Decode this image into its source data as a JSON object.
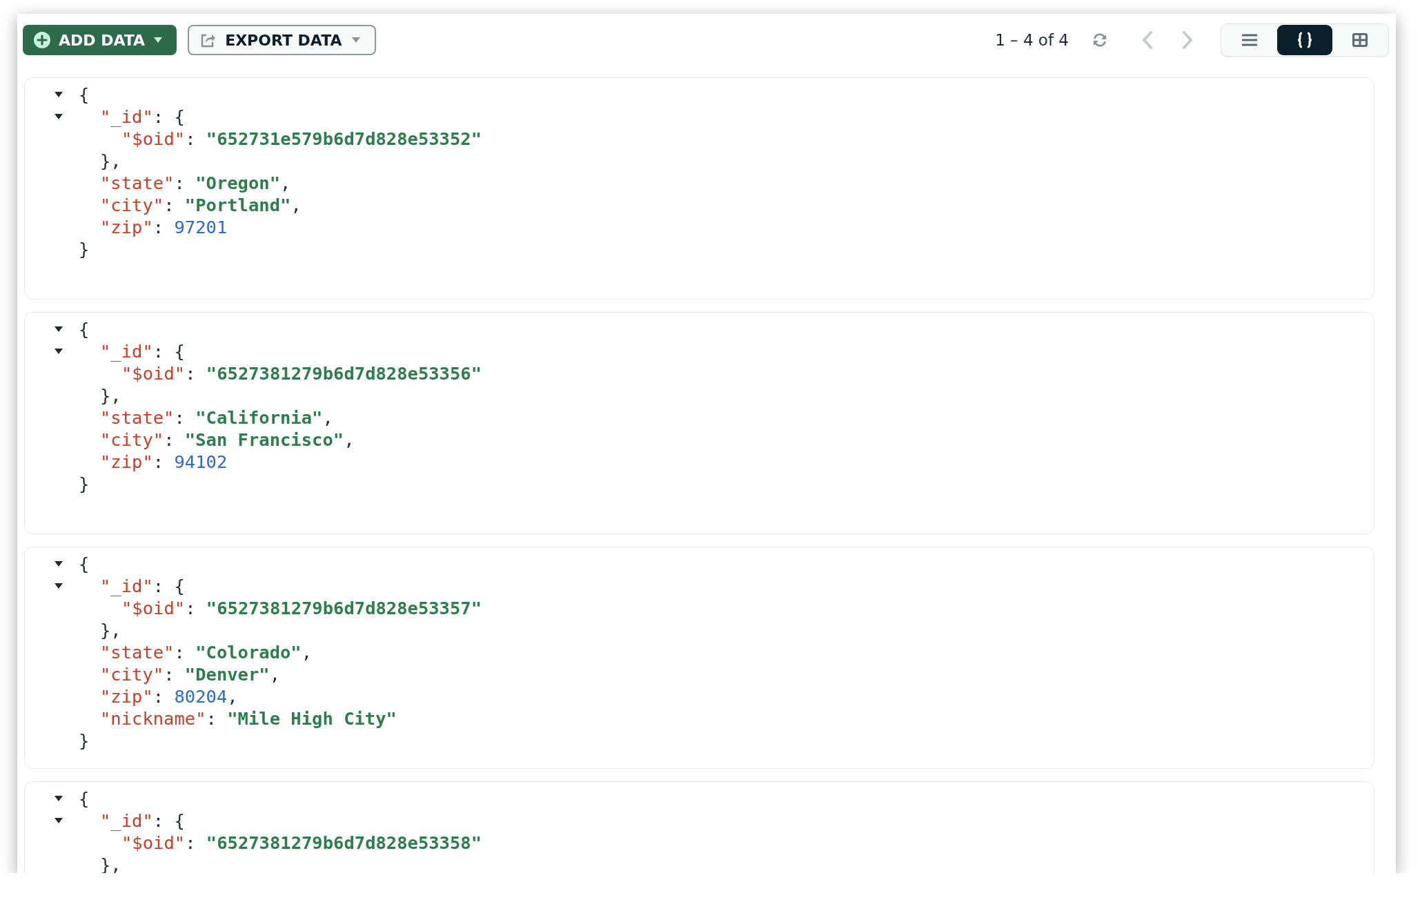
{
  "toolbar": {
    "add_button": {
      "label": "ADD DATA"
    },
    "export_button": {
      "label": "EXPORT DATA"
    },
    "pager": {
      "text": "1 – 4 of 4",
      "prev_disabled": true,
      "next_disabled": true
    },
    "views": [
      {
        "kind": "list",
        "selected": false
      },
      {
        "kind": "json",
        "selected": true
      },
      {
        "kind": "table",
        "selected": false
      }
    ]
  },
  "documents": [
    {
      "expanded": true,
      "open": "{",
      "close": "}",
      "children": [
        {
          "key": "\"_id\"",
          "colon": ":",
          "kind": "object",
          "expanded": true,
          "open": "{",
          "close": "},",
          "children": [
            {
              "key": "\"$oid\"",
              "colon": ":",
              "kind": "string",
              "value": "\"652731e579b6d7d828e53352\""
            }
          ]
        },
        {
          "key": "\"state\"",
          "colon": ":",
          "kind": "string",
          "value": "\"Oregon\"",
          "comma": ","
        },
        {
          "key": "\"city\"",
          "colon": ":",
          "kind": "string",
          "value": "\"Portland\"",
          "comma": ","
        },
        {
          "key": "\"zip\"",
          "colon": ":",
          "kind": "number",
          "value": "97201"
        }
      ]
    },
    {
      "expanded": true,
      "open": "{",
      "close": "}",
      "children": [
        {
          "key": "\"_id\"",
          "colon": ":",
          "kind": "object",
          "expanded": true,
          "open": "{",
          "close": "},",
          "children": [
            {
              "key": "\"$oid\"",
              "colon": ":",
              "kind": "string",
              "value": "\"6527381279b6d7d828e53356\""
            }
          ]
        },
        {
          "key": "\"state\"",
          "colon": ":",
          "kind": "string",
          "value": "\"California\"",
          "comma": ","
        },
        {
          "key": "\"city\"",
          "colon": ":",
          "kind": "string",
          "value": "\"San Francisco\"",
          "comma": ","
        },
        {
          "key": "\"zip\"",
          "colon": ":",
          "kind": "number",
          "value": "94102"
        }
      ]
    },
    {
      "expanded": true,
      "open": "{",
      "close": "}",
      "children": [
        {
          "key": "\"_id\"",
          "colon": ":",
          "kind": "object",
          "expanded": true,
          "open": "{",
          "close": "},",
          "children": [
            {
              "key": "\"$oid\"",
              "colon": ":",
              "kind": "string",
              "value": "\"6527381279b6d7d828e53357\""
            }
          ]
        },
        {
          "key": "\"state\"",
          "colon": ":",
          "kind": "string",
          "value": "\"Colorado\"",
          "comma": ","
        },
        {
          "key": "\"city\"",
          "colon": ":",
          "kind": "string",
          "value": "\"Denver\"",
          "comma": ","
        },
        {
          "key": "\"zip\"",
          "colon": ":",
          "kind": "number",
          "value": "80204",
          "comma": ","
        },
        {
          "key": "\"nickname\"",
          "colon": ":",
          "kind": "string",
          "value": "\"Mile High City\""
        }
      ]
    },
    {
      "expanded": true,
      "open": "{",
      "children": [
        {
          "key": "\"_id\"",
          "colon": ":",
          "kind": "object",
          "expanded": true,
          "open": "{",
          "close": "},",
          "children": [
            {
              "key": "\"$oid\"",
              "colon": ":",
              "kind": "string",
              "value": "\"6527381279b6d7d828e53358\""
            }
          ]
        }
      ]
    }
  ]
}
